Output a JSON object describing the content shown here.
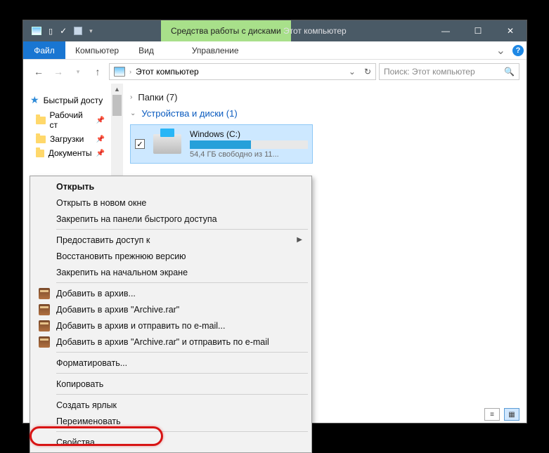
{
  "titlebar": {
    "ribbon_tab": "Средства работы с дисками",
    "title": "Этот компьютер"
  },
  "sys": {
    "min": "—",
    "max": "☐",
    "close": "✕"
  },
  "menu": {
    "file": "Файл",
    "computer": "Компьютер",
    "view": "Вид",
    "manage": "Управление"
  },
  "address": {
    "location": "Этот компьютер",
    "dropdown": "⌄",
    "refresh": "↻"
  },
  "search": {
    "placeholder": "Поиск: Этот компьютер"
  },
  "sidebar": {
    "quick": "Быстрый досту",
    "items": [
      {
        "label": "Рабочий ст"
      },
      {
        "label": "Загрузки"
      },
      {
        "label": "Документы"
      }
    ]
  },
  "groups": {
    "folders": "Папки (7)",
    "devices": "Устройства и диски (1)"
  },
  "drive": {
    "name": "Windows (C:)",
    "free": "54,4 ГБ свободно из 11..."
  },
  "context_menu": {
    "open": "Открыть",
    "open_new": "Открыть в новом окне",
    "pin_quick": "Закрепить на панели быстрого доступа",
    "grant_access": "Предоставить доступ к",
    "restore_prev": "Восстановить прежнюю версию",
    "pin_start": "Закрепить на начальном экране",
    "add_archive": "Добавить в архив...",
    "add_archive_rar": "Добавить в архив \"Archive.rar\"",
    "add_send": "Добавить в архив и отправить по e-mail...",
    "add_rar_send": "Добавить в архив \"Archive.rar\" и отправить по e-mail",
    "format": "Форматировать...",
    "copy": "Копировать",
    "create_shortcut": "Создать ярлык",
    "rename": "Переименовать",
    "properties": "Свойства"
  }
}
